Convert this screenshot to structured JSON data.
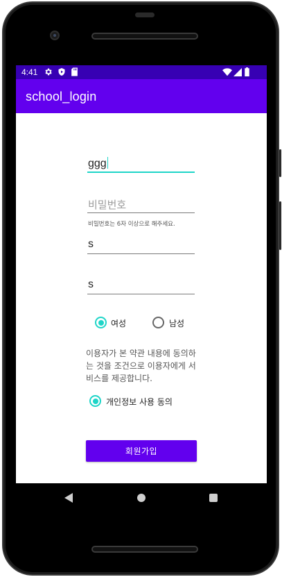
{
  "status": {
    "time": "4:41",
    "icons": [
      "settings-icon",
      "play-protect-icon",
      "sd-card-icon",
      "wifi-icon",
      "signal-icon",
      "battery-icon"
    ]
  },
  "app": {
    "title": "school_login"
  },
  "form": {
    "id_field": {
      "value": "ggg",
      "placeholder": ""
    },
    "password_field": {
      "value": "",
      "placeholder": "비밀번호"
    },
    "password_hint": "비밀번호는 6자 이상으로 해주세요.",
    "field3": {
      "value": "s"
    },
    "field4": {
      "value": "s"
    },
    "gender": {
      "female_label": "여성",
      "male_label": "남성",
      "selected": "여성"
    },
    "terms_notice": "이용자가 본 약관 내용에 동의하\n는 것을 조건으로 이용자에게 서\n비스를 제공합니다.",
    "privacy_consent_label": "개인정보 사용 동의",
    "signup_button": "회원가입"
  },
  "colors": {
    "primary": "#6200ee",
    "primary_dark": "#3700b3",
    "accent": "#1ed5c8"
  },
  "navbar": {
    "icons": [
      "back-icon",
      "home-icon",
      "recents-icon"
    ]
  }
}
